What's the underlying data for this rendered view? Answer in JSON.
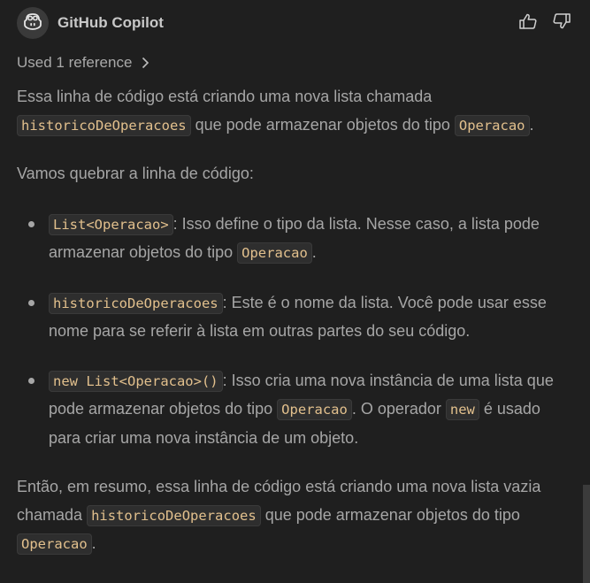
{
  "header": {
    "author": "GitHub Copilot",
    "avatar_icon": "copilot-icon",
    "helpful_icon": "thumbs-up-icon",
    "unhelpful_icon": "thumbs-down-icon"
  },
  "references": {
    "label": "Used 1 reference",
    "icon": "chevron-right-icon"
  },
  "message": {
    "intro": {
      "t1": "Essa linha de código está criando uma nova lista chamada ",
      "c1": "historicoDeOperacoes",
      "t2": " que pode armazenar objetos do tipo ",
      "c2": "Operacao",
      "t3": "."
    },
    "lead": "Vamos quebrar a linha de código:",
    "bullets": [
      {
        "c1": "List<Operacao>",
        "t1": ": Isso define o tipo da lista. Nesse caso, a lista pode armazenar objetos do tipo ",
        "c2": "Operacao",
        "t2": "."
      },
      {
        "c1": "historicoDeOperacoes",
        "t1": ": Este é o nome da lista. Você pode usar esse nome para se referir à lista em outras partes do seu código."
      },
      {
        "c1": "new List<Operacao>()",
        "t1": ": Isso cria uma nova instância de uma lista que pode armazenar objetos do tipo ",
        "c2": "Operacao",
        "t2": ". O operador ",
        "c3": "new",
        "t3": " é usado para criar uma nova instância de um objeto."
      }
    ],
    "summary": {
      "t1": "Então, em resumo, essa linha de código está criando uma nova lista vazia chamada ",
      "c1": "historicoDeOperacoes",
      "t2": " que pode armazenar objetos do tipo ",
      "c2": "Operacao",
      "t3": "."
    }
  },
  "colors": {
    "background": "#1f1f1f",
    "text": "#a6a6a6",
    "code_text": "#e2c08d",
    "code_bg": "#2e2e2e"
  }
}
